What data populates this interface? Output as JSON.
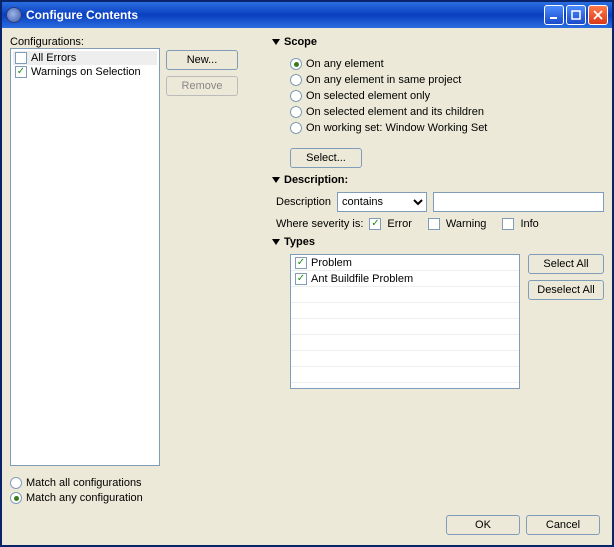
{
  "title": "Configure Contents",
  "left": {
    "label": "Configurations:",
    "items": [
      {
        "label": "All Errors",
        "checked": false
      },
      {
        "label": "Warnings on Selection",
        "checked": true
      }
    ],
    "new_btn": "New...",
    "remove_btn": "Remove",
    "match_all": "Match all configurations",
    "match_any": "Match any configuration",
    "match_sel": "any"
  },
  "scope": {
    "header": "Scope",
    "options": [
      "On any element",
      "On any element in same project",
      "On selected element only",
      "On selected element and its children",
      "On working set:  Window Working Set"
    ],
    "selected": 0,
    "select_btn": "Select..."
  },
  "description": {
    "header": "Description:",
    "field_label": "Description",
    "combo_value": "contains",
    "text_value": "",
    "severity_label": "Where severity is:",
    "error": {
      "label": "Error",
      "checked": true
    },
    "warning": {
      "label": "Warning",
      "checked": false
    },
    "info": {
      "label": "Info",
      "checked": false
    }
  },
  "types": {
    "header": "Types",
    "items": [
      {
        "label": "Problem",
        "checked": true
      },
      {
        "label": "Ant Buildfile Problem",
        "checked": true
      }
    ],
    "select_all": "Select All",
    "deselect_all": "Deselect All"
  },
  "footer": {
    "ok": "OK",
    "cancel": "Cancel"
  }
}
